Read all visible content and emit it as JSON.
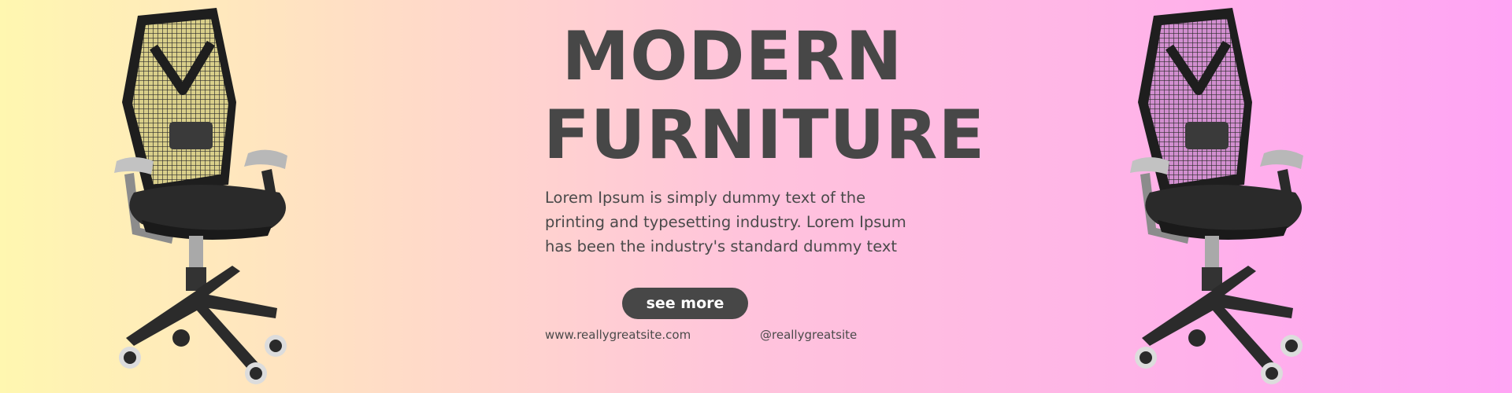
{
  "banner": {
    "gradient_start": "#fff7b0",
    "gradient_mid": "#ffc3dc",
    "gradient_end": "#ffa4f4",
    "title_line1": "MODERN",
    "title_line2": "FURNITURE",
    "description": "Lorem Ipsum is simply dummy text of the printing and typesetting industry. Lorem Ipsum has been the industry's standard dummy text",
    "button_label": "see more",
    "website": "www.reallygreatsite.com",
    "handle": "@reallygreatsite",
    "text_color": "#474747"
  },
  "images": {
    "left": {
      "icon": "office-chair-icon",
      "mesh_color": "#d9cf8a"
    },
    "right": {
      "icon": "office-chair-icon",
      "mesh_color": "#d28fd0"
    }
  }
}
